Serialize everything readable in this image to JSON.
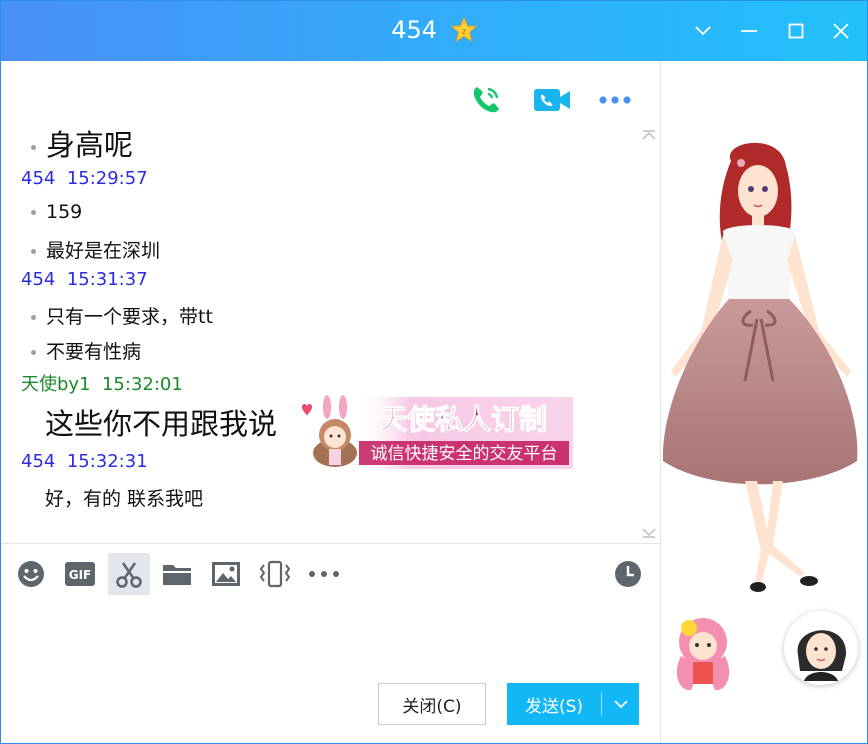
{
  "window": {
    "title": "454",
    "title_badge_icon": "star-badge-icon",
    "controls": [
      "chevron-down-icon",
      "minimize-icon",
      "maximize-icon",
      "close-icon"
    ]
  },
  "toolbar_top": {
    "icons": [
      "phone-call-icon",
      "video-call-icon",
      "more-icon"
    ],
    "colors": {
      "phone": "#13c56b",
      "video": "#1bb3f0",
      "more": "#4b8ff5"
    }
  },
  "messages": [
    {
      "type": "text",
      "bullet": true,
      "size": "big",
      "text": "身高呢"
    },
    {
      "type": "meta",
      "sender": "454",
      "time": "15:29:57",
      "self": false
    },
    {
      "type": "text",
      "bullet": true,
      "size": "normal",
      "text": "159"
    },
    {
      "type": "text",
      "bullet": true,
      "size": "normal",
      "text": "最好是在深圳"
    },
    {
      "type": "meta",
      "sender": "454",
      "time": "15:31:37",
      "self": false
    },
    {
      "type": "text",
      "bullet": true,
      "size": "normal",
      "text": "只有一个要求，带tt"
    },
    {
      "type": "text",
      "bullet": true,
      "size": "normal",
      "text": "不要有性病"
    },
    {
      "type": "meta",
      "sender": "天使by1",
      "time": "15:32:01",
      "self": true
    },
    {
      "type": "text",
      "bullet": false,
      "size": "big",
      "text": "这些你不用跟我说"
    },
    {
      "type": "meta",
      "sender": "454",
      "time": "15:32:31",
      "self": false
    },
    {
      "type": "text",
      "bullet": false,
      "size": "normal",
      "text": "好，有的 联系我吧"
    }
  ],
  "ad": {
    "headline": "天使私人订制",
    "subline": "诚信快捷安全的交友平台"
  },
  "input_toolbar": {
    "icons": [
      "emoji-icon",
      "gif-icon",
      "scissors-icon",
      "folder-icon",
      "image-icon",
      "shake-icon",
      "more-icon",
      "history-clock-icon"
    ],
    "gif_label": "GIF",
    "active": "scissors-icon"
  },
  "buttons": {
    "close_label": "关闭(C)",
    "send_label": "发送(S)"
  },
  "colors": {
    "titlebar_start": "#4a8ff6",
    "titlebar_end": "#22c1fb",
    "meta_other": "#2b2be0",
    "meta_self": "#1c8a2a",
    "send_button": "#12b7f5"
  }
}
